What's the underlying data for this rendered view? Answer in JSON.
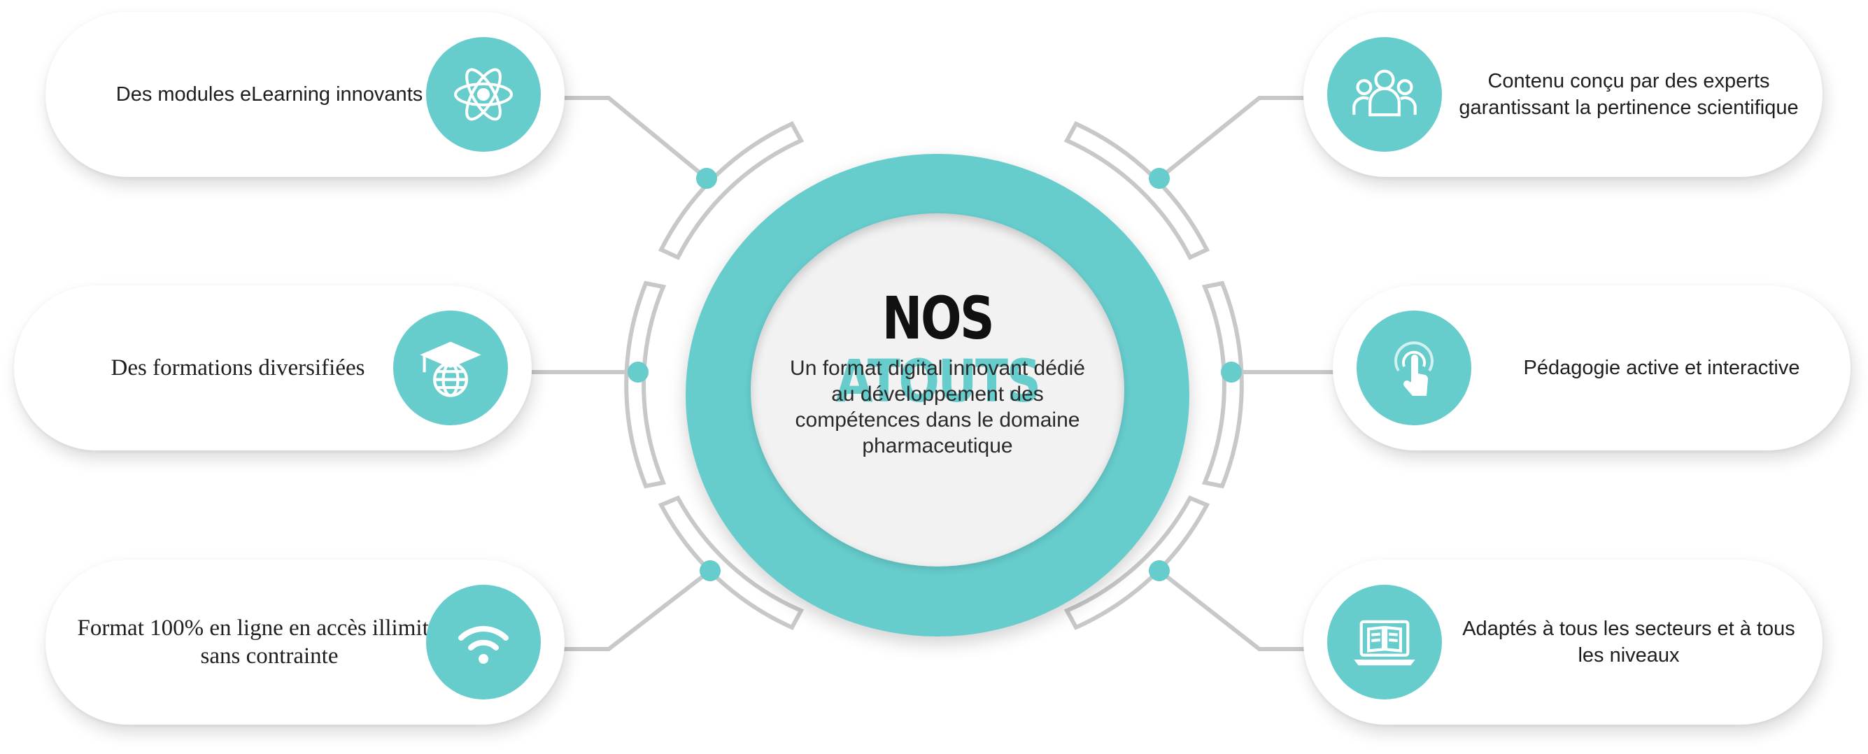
{
  "center": {
    "title_part1": "NOS",
    "title_part2": "ATOUTS",
    "description": "Un format digital innovant dédié au développement des compétences dans le domaine pharmaceutique"
  },
  "features": {
    "left": [
      {
        "label": "Des modules eLearning innovants",
        "icon": "atom-icon"
      },
      {
        "label": "Des formations diversifiées",
        "icon": "graduation-globe-icon"
      },
      {
        "label": "Format 100% en ligne en accès illimité et sans contrainte",
        "icon": "wifi-icon"
      }
    ],
    "right": [
      {
        "label": "Contenu conçu par des experts garantissant la pertinence scientifique",
        "icon": "users-group-icon"
      },
      {
        "label": "Pédagogie active et interactive",
        "icon": "touch-hand-icon"
      },
      {
        "label": "Adaptés à tous les secteurs et à tous les niveaux",
        "icon": "laptop-book-icon"
      }
    ]
  },
  "colors": {
    "accent": "#66cccc",
    "title_dark": "#111111",
    "connector": "#c8c8c8"
  }
}
